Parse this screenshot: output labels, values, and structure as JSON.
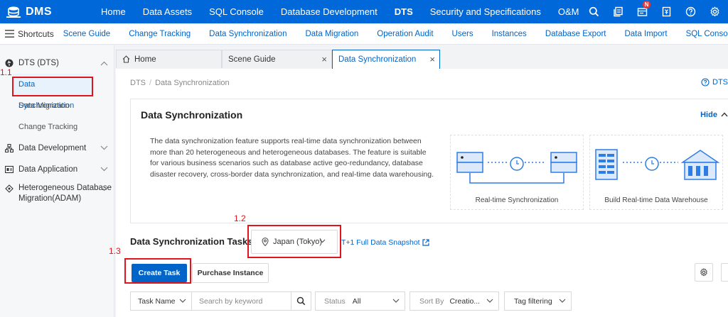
{
  "topnav": {
    "logo": "DMS",
    "items": [
      "Home",
      "Data Assets",
      "SQL Console",
      "Database Development",
      "DTS",
      "Security and Specifications",
      "O&M"
    ],
    "notification_badge": "N",
    "brand_color": "#0068d9"
  },
  "shortcuts": {
    "label": "Shortcuts",
    "items": [
      "Scene Guide",
      "Change Tracking",
      "Data Synchronization",
      "Data Migration",
      "Operation Audit",
      "Users",
      "Instances",
      "Database Export",
      "Data Import",
      "SQL Console"
    ]
  },
  "sidebar": {
    "group_dts": "DTS (DTS)",
    "sub_items": [
      "Data Synchronization",
      "Data Migration",
      "Change Tracking"
    ],
    "group_dev": "Data Development",
    "group_app": "Data Application",
    "group_adam_line1": "Heterogeneous Database",
    "group_adam_line2": "Migration(ADAM)"
  },
  "tabs": {
    "home": "Home",
    "scene_guide": "Scene Guide",
    "data_sync": "Data Synchronization"
  },
  "breadcrumb": {
    "root": "DTS",
    "current": "Data Synchronization"
  },
  "help_link": "DTS",
  "intro": {
    "title": "Data Synchronization",
    "hide": "Hide",
    "description": "The data synchronization feature supports real-time data synchronization between more than 20 heterogeneous and heterogeneous databases. The feature is suitable for various business scenarios such as database active geo-redundancy, database disaster recovery, cross-border data synchronization, and real-time data warehousing.",
    "illus1_caption": "Real-time Synchronization",
    "illus2_caption": "Build Real-time Data Warehouse"
  },
  "tasks": {
    "title": "Data Synchronization Tasks",
    "region": "Japan (Tokyo)",
    "snapshot_link": "T+1 Full Data Snapshot",
    "create_task": "Create Task",
    "purchase_instance": "Purchase Instance"
  },
  "filters": {
    "task_name": "Task Name",
    "search_placeholder": "Search by keyword",
    "status_label": "Status",
    "status_value": "All",
    "sort_label": "Sort By",
    "sort_value": "Creatio...",
    "tag_filtering": "Tag filtering"
  },
  "annotations": {
    "a1": "1.1",
    "a2": "1.2",
    "a3": "1.3",
    "color": "#e0151b"
  }
}
